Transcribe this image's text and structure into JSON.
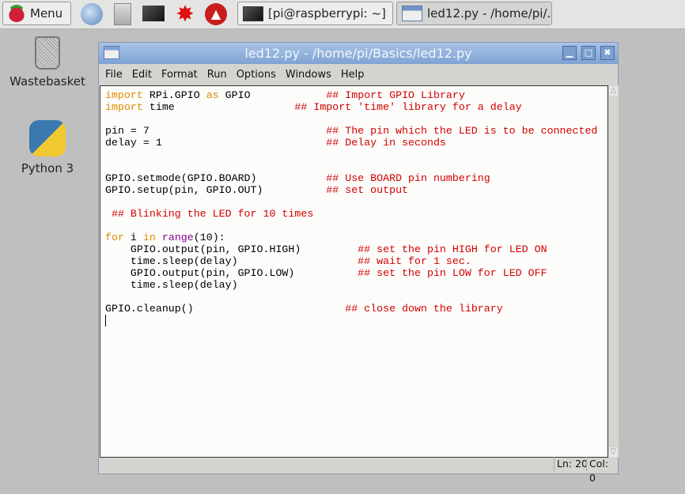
{
  "taskbar": {
    "menu_label": "Menu",
    "tasks": [
      {
        "label": "[pi@raspberrypi: ~]"
      },
      {
        "label": "led12.py - /home/pi/..."
      }
    ]
  },
  "desktop": {
    "icons": [
      {
        "label": "Wastebasket"
      },
      {
        "label": "Python 3"
      }
    ]
  },
  "window": {
    "title": "led12.py - /home/pi/Basics/led12.py",
    "menu": [
      "File",
      "Edit",
      "Format",
      "Run",
      "Options",
      "Windows",
      "Help"
    ],
    "status": {
      "line": "Ln: 20",
      "col": "Col: 0"
    }
  },
  "code": [
    [
      [
        "kw",
        "import"
      ],
      [
        "",
        "    RPi.GPIO "
      ],
      [
        "kw",
        "as"
      ],
      [
        "",
        "GPIO"
      ],
      [
        "cm",
        "            ## Import GPIO Library"
      ]
    ],
    [
      [
        "kw",
        "import"
      ],
      [
        "",
        ""
      ],
      [
        "",
        ""
      ],
      [
        "",
        "    time"
      ],
      [
        "cm",
        "                   ## Import 'time' library for a delay"
      ]
    ],
    [],
    [
      [
        "",
        "pin = 7"
      ],
      [
        "cm",
        "                            ## The pin which the LED is to be connected"
      ]
    ],
    [
      [
        "",
        "delay = 1"
      ],
      [
        "cm",
        "                          ## Delay in seconds"
      ]
    ],
    [],
    [],
    [
      [
        "",
        "GPIO.setmode(GPIO.BOARD)"
      ],
      [
        "cm",
        "           ## Use BOARD pin numbering"
      ]
    ],
    [
      [
        "",
        "GPIO.setup(pin, GPIO.OUT)"
      ],
      [
        "cm",
        "          ## set output"
      ]
    ],
    [],
    [
      [
        "cm",
        " ## Blinking the LED for 10 times"
      ]
    ],
    [],
    [
      [
        "kw",
        "for"
      ],
      [
        "",
        " i "
      ],
      [
        "kw",
        "in"
      ],
      [
        "",
        " "
      ],
      [
        "bi",
        "range"
      ],
      [
        "",
        "(10):"
      ]
    ],
    [
      [
        "",
        "    GPIO.output(pin, GPIO.HIGH)"
      ],
      [
        "cm",
        "         ## set the pin HIGH for LED ON"
      ]
    ],
    [
      [
        "",
        "    time.sleep(delay)"
      ],
      [
        "cm",
        "                   ## wait for 1 sec."
      ]
    ],
    [
      [
        "",
        "    GPIO.output(pin, GPIO.LOW)"
      ],
      [
        "cm",
        "          ## set the pin LOW for LED OFF"
      ]
    ],
    [
      [
        "",
        "    time.sleep(delay)"
      ]
    ],
    [],
    [
      [
        "",
        "GPIO.cleanup()"
      ],
      [
        "cm",
        "                        ## close down the library"
      ]
    ]
  ]
}
